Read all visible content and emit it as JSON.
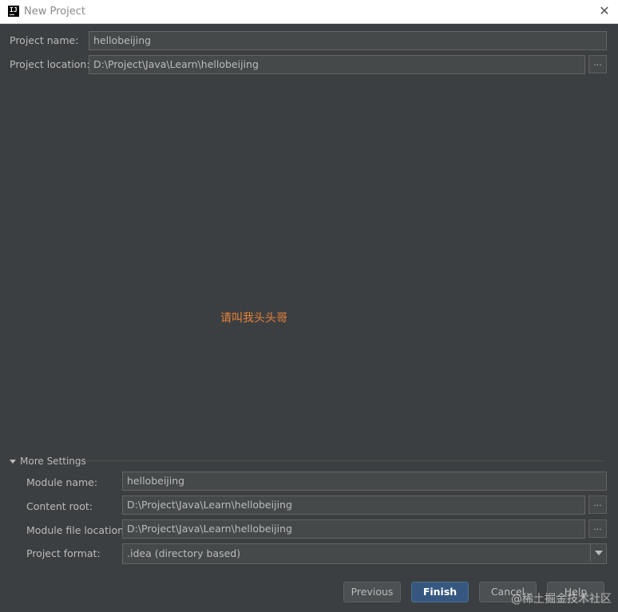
{
  "window": {
    "title": "New Project",
    "close_glyph": "✕"
  },
  "form": {
    "project_name_label": "Project name:",
    "project_name_value": "hellobeijing",
    "project_location_label": "Project location:",
    "project_location_value": "D:\\Project\\Java\\Learn\\hellobeijing",
    "browse_glyph": "..."
  },
  "overlay_text": "请叫我头头哥",
  "more_settings": {
    "label": "More Settings",
    "module_name_label": "Module name:",
    "module_name_value": "hellobeijing",
    "content_root_label": "Content root:",
    "content_root_value": "D:\\Project\\Java\\Learn\\hellobeijing",
    "module_file_location_label": "Module file location:",
    "module_file_location_value": "D:\\Project\\Java\\Learn\\hellobeijing",
    "project_format_label": "Project format:",
    "project_format_value": ".idea (directory based)"
  },
  "buttons": {
    "previous": "Previous",
    "finish": "Finish",
    "cancel": "Cancel",
    "help": "Help"
  },
  "credit_text": "@稀土掘金技术社区",
  "colors": {
    "background": "#3c3f41",
    "field_bg": "#45494a",
    "primary_button": "#365880",
    "accent_text": "#e8833a"
  }
}
